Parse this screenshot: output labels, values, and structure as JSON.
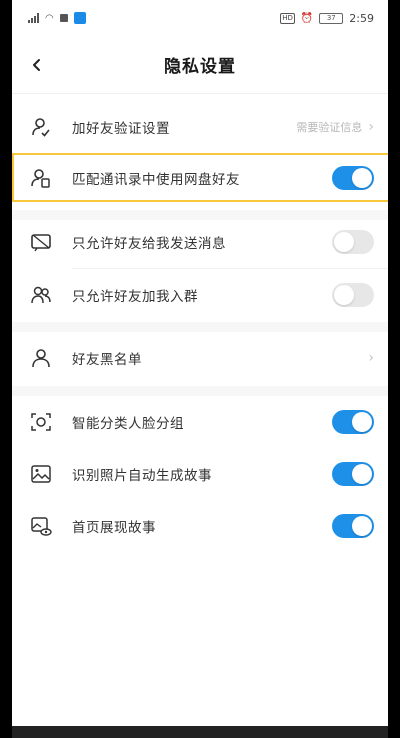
{
  "status_bar": {
    "time": "2:59",
    "battery": "37",
    "network": "HD"
  },
  "header": {
    "title": "隐私设置",
    "back_icon": "chevron-left-icon"
  },
  "rows": [
    {
      "label": "加好友验证设置",
      "hint": "需要验证信息",
      "icon": "user-verify-icon",
      "control": "chevron"
    },
    {
      "label": "匹配通讯录中使用网盘好友",
      "icon": "contacts-icon",
      "control": "toggle",
      "on": true,
      "highlighted": true
    },
    {
      "label": "只允许好友给我发送消息",
      "icon": "message-icon",
      "control": "toggle",
      "on": false
    },
    {
      "label": "只允许好友加我入群",
      "icon": "group-icon",
      "control": "toggle",
      "on": false
    },
    {
      "label": "好友黑名单",
      "icon": "user-icon",
      "control": "chevron"
    },
    {
      "label": "智能分类人脸分组",
      "icon": "face-scan-icon",
      "control": "toggle",
      "on": true
    },
    {
      "label": "识别照片自动生成故事",
      "icon": "photo-icon",
      "control": "toggle",
      "on": true
    },
    {
      "label": "首页展现故事",
      "icon": "photo-eye-icon",
      "control": "toggle",
      "on": true
    }
  ],
  "colors": {
    "accent": "#1e90e8",
    "highlight": "#f6c83a"
  }
}
